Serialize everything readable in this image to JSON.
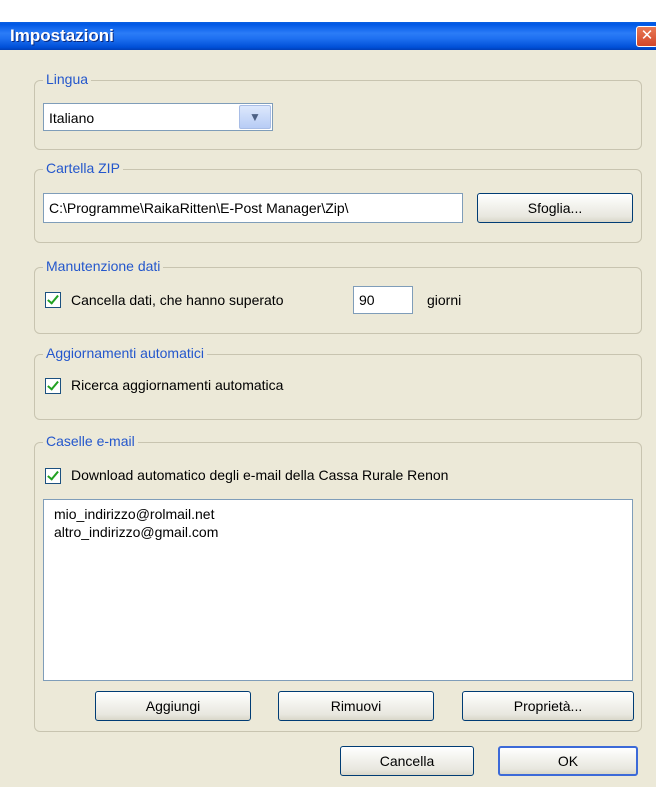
{
  "window": {
    "title": "Impostazioni",
    "close_glyph": "✕"
  },
  "language": {
    "legend": "Lingua",
    "selected": "Italiano"
  },
  "zip": {
    "legend": "Cartella ZIP",
    "path": "C:\\Programme\\RaikaRitten\\E-Post Manager\\Zip\\",
    "browse_label": "Sfoglia..."
  },
  "maintenance": {
    "legend": "Manutenzione dati",
    "checkbox_label": "Cancella dati, che hanno superato",
    "days": "90",
    "unit_label": "giorni"
  },
  "updates": {
    "legend": "Aggiornamenti automatici",
    "checkbox_label": "Ricerca aggiornamenti automatica"
  },
  "mailboxes": {
    "legend": "Caselle e-mail",
    "checkbox_label": "Download automatico degli e-mail della Cassa Rurale Renon",
    "items": [
      "mio_indirizzo@rolmail.net",
      "altro_indirizzo@gmail.com"
    ],
    "add_label": "Aggiungi",
    "remove_label": "Rimuovi",
    "properties_label": "Proprietà..."
  },
  "footer": {
    "cancel_label": "Cancella",
    "ok_label": "OK"
  },
  "colors": {
    "titlebar": "#0058e6",
    "face": "#ece9d8",
    "legend": "#2457cc"
  }
}
